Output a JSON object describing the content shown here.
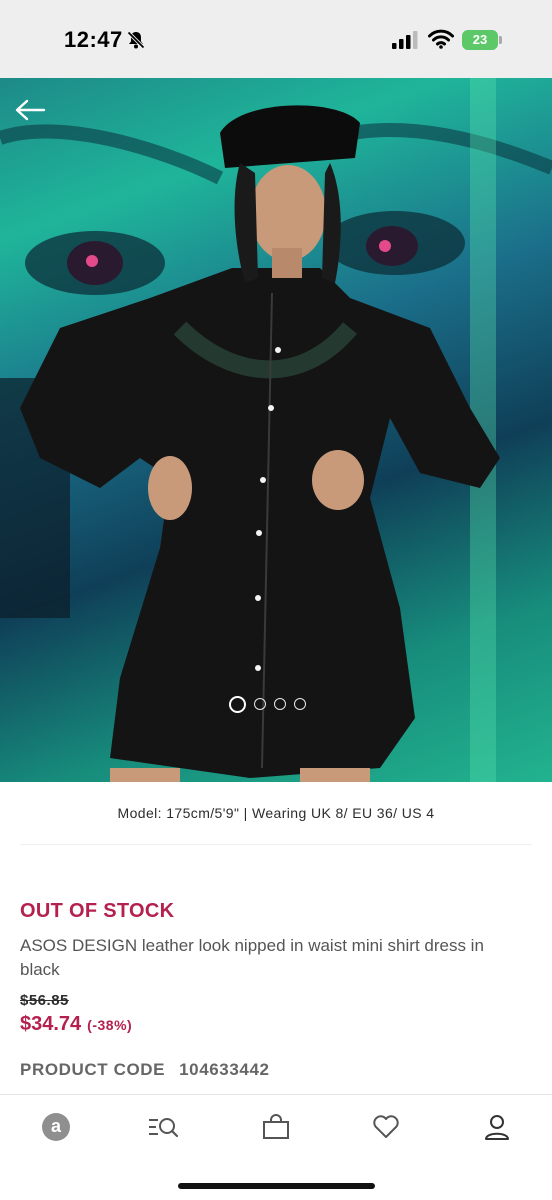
{
  "status_bar": {
    "time": "12:47",
    "battery": "23",
    "icons": [
      "bell-slash-icon",
      "signal-icon",
      "wifi-icon",
      "battery-icon"
    ]
  },
  "hero": {
    "back_icon": "arrow-left-icon",
    "carousel": {
      "total": 4,
      "active": 0
    }
  },
  "product": {
    "model_info": "Model: 175cm/5'9\" | Wearing UK 8/ EU 36/ US 4",
    "stock_status": "OUT OF STOCK",
    "title": "ASOS DESIGN leather look nipped in waist mini shirt dress in black",
    "old_price": "$56.85",
    "new_price": "$34.74",
    "discount": "(-38%)",
    "code_label": "PRODUCT CODE",
    "code_value": "104633442"
  },
  "bottom_nav": {
    "items": [
      {
        "icon": "asos-home-icon",
        "label": "a"
      },
      {
        "icon": "search-filter-icon"
      },
      {
        "icon": "shopping-bag-icon"
      },
      {
        "icon": "heart-icon"
      },
      {
        "icon": "account-icon"
      }
    ]
  },
  "colors": {
    "accent": "#b4214f",
    "status_bar_bg": "#eeeeee",
    "battery": "#5cc867",
    "nav_icon": "#555555"
  }
}
